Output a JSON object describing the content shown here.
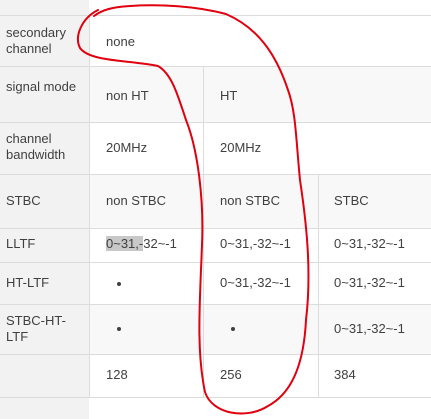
{
  "rows": [
    {
      "label": "secondary channel",
      "values": [
        "none"
      ]
    },
    {
      "label": "signal mode",
      "values": [
        "non HT",
        "HT"
      ]
    },
    {
      "label": "channel bandwidth",
      "values": [
        "20MHz",
        "20MHz"
      ]
    },
    {
      "label": "STBC",
      "values": [
        "non STBC",
        "non STBC",
        "STBC"
      ]
    },
    {
      "label": "LLTF",
      "values": [
        "0~31,-32~-1",
        "0~31,-32~-1",
        "0~31,-32~-1"
      ],
      "highlight": "0~31,-"
    },
    {
      "label": "HT-LTF",
      "values": [
        "•",
        "0~31,-32~-1",
        "0~31,-32~-1"
      ]
    },
    {
      "label": "STBC-HT-LTF",
      "values": [
        "•",
        "•",
        "0~31,-32~-1"
      ]
    },
    {
      "label": "",
      "values": [
        "128",
        "256",
        "384"
      ]
    }
  ],
  "lltf_first": {
    "highlighted": "0~31,-",
    "rest": "32~-1"
  },
  "annotation": {
    "stroke_color": "#e0000f"
  },
  "colors": {
    "label_bg": "#f2f2f2",
    "alt_row_bg": "#f8f8f8",
    "border": "#dcdcdc",
    "text": "#404040"
  }
}
